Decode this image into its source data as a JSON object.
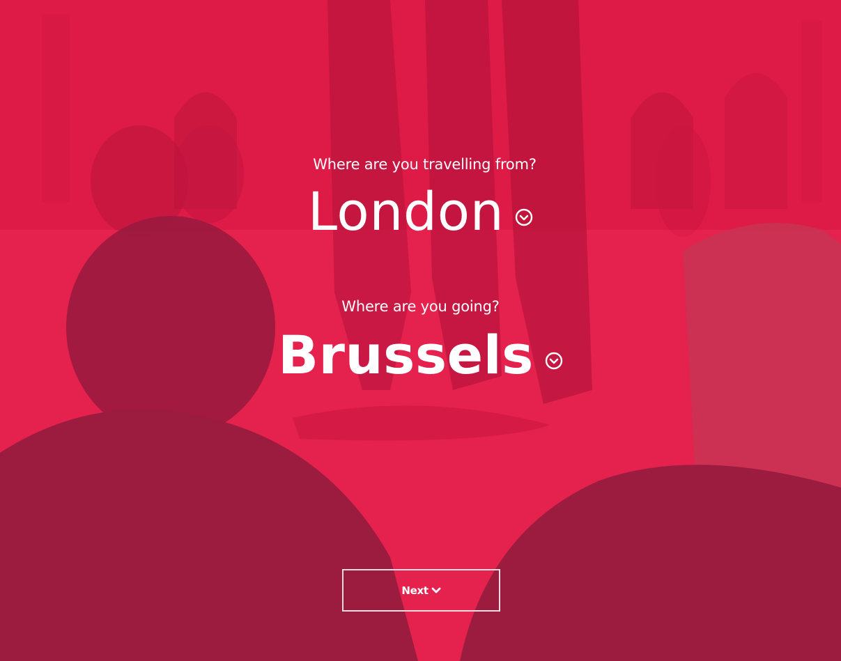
{
  "trip": {
    "from_question": "Where are you travelling from?",
    "from_city": "London",
    "to_question": "Where are you going?",
    "to_city": "Brussels"
  },
  "actions": {
    "next_label": "Next"
  },
  "icons": {
    "from_dropdown": "chevron-circle-down-icon",
    "to_dropdown": "chevron-circle-down-icon",
    "next": "chevron-down-icon"
  },
  "colors": {
    "overlay": "#e01c48",
    "text": "#ffffff"
  }
}
